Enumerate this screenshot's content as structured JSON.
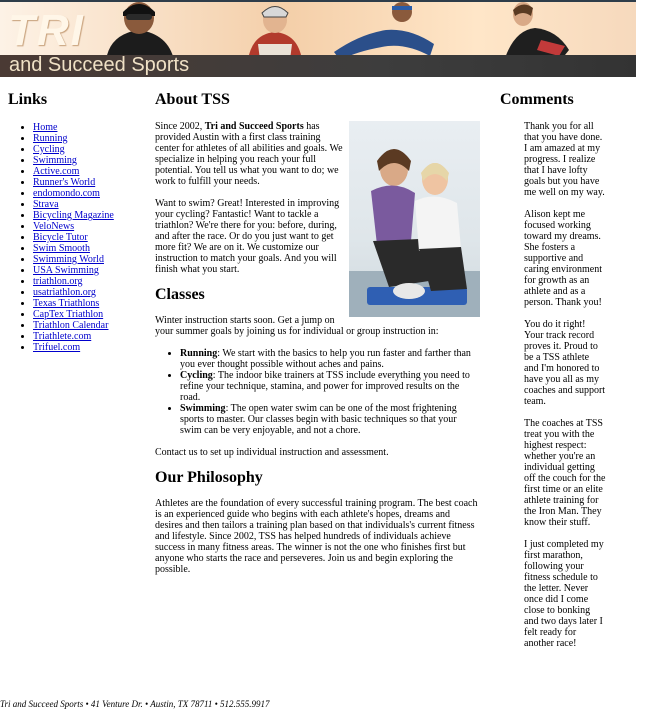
{
  "banner": {
    "logo_text": "TRI",
    "tagline": "and Succeed Sports"
  },
  "links": {
    "heading": "Links",
    "items": [
      "Home",
      "Running",
      "Cycling",
      "Swimming",
      "Active.com",
      "Runner's World",
      "endomondo.com",
      "Strava",
      "Bicycling Magazine",
      "VeloNews",
      "Bicycle Tutor",
      "Swim Smooth",
      "Swimming World",
      "USA Swimming",
      "triathlon.org",
      "usatriathlon.org",
      "Texas Triathlons",
      "CapTex Triathlon",
      "Triathlon Calendar",
      "Triathlete.com",
      "Trifuel.com"
    ]
  },
  "about": {
    "heading": "About TSS",
    "p1_pre": "Since 2002, ",
    "p1_bold": "Tri and Succeed Sports",
    "p1_post": " has provided Austin with a first class training center for athletes of all abilities and goals. We specialize in helping you reach your full potential. You tell us what you want to do; we work to fulfill your needs.",
    "p2": "Want to swim? Great! Interested in improving your cycling? Fantastic! Want to tackle a triathlon? We're there for you: before, during, and after the race. Or do you just want to get more fit? We are on it. We customize our instruction to match your goals. And you will finish what you start."
  },
  "classes": {
    "heading": "Classes",
    "intro": "Winter instruction starts soon. Get a jump on your summer goals by joining us for individual or group instruction in:",
    "items": [
      {
        "name": "Running",
        "text": ": We start with the basics to help you run faster and farther than you ever thought possible without aches and pains."
      },
      {
        "name": "Cycling",
        "text": ": The indoor bike trainers at TSS include everything you need to refine your technique, stamina, and power for improved results on the road."
      },
      {
        "name": "Swimming",
        "text": ": The open water swim can be one of the most frightening sports to master. Our classes begin with basic techniques so that your swim can be very enjoyable, and not a chore."
      }
    ],
    "contact": "Contact us to set up individual instruction and assessment."
  },
  "philosophy": {
    "heading": "Our Philosophy",
    "text": "Athletes are the foundation of every successful training program. The best coach is an experienced guide who begins with each athlete's hopes, dreams and desires and then tailors a training plan based on that individuals's current fitness and lifestyle. Since 2002, TSS has helped hundreds of individuals achieve success in many fitness areas. The winner is not the one who finishes first but anyone who starts the race and perseveres. Join us and begin exploring the possible."
  },
  "comments": {
    "heading": "Comments",
    "items": [
      "Thank you for all that you have done. I am amazed at my progress. I realize that I have lofty goals but you have me well on my way.",
      "Alison kept me focused working toward my dreams. She fosters a supportive and caring environment for growth as an athlete and as a person. Thank you!",
      "You do it right! Your track record proves it. Proud to be a TSS athlete and I'm honored to have you all as my coaches and support team.",
      "The coaches at TSS treat you with the highest respect: whether you're an individual getting off the couch for the first time or an elite athlete training for the Iron Man. They know their stuff.",
      "I just completed my first marathon, following your fitness schedule to the letter. Never once did I come close to bonking and two days later I felt ready for another race!"
    ]
  },
  "footer": {
    "text": "Tri and Succeed Sports • 41 Venture Dr. • Austin, TX 78711 • 512.555.9917"
  },
  "colors": {
    "link": "#0000cc",
    "banner_strip": "#3d3d3d"
  }
}
